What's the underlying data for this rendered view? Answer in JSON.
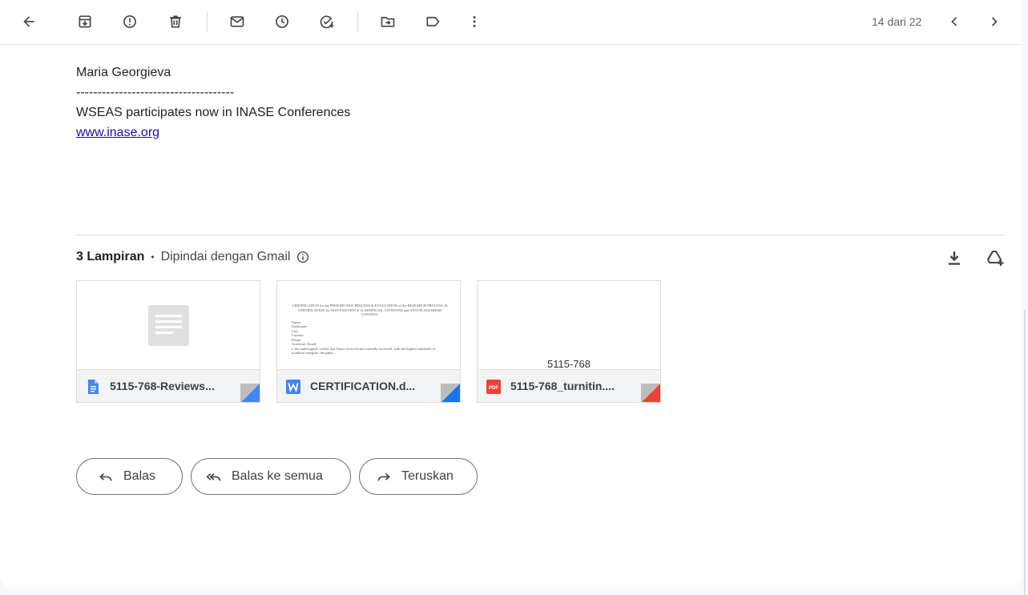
{
  "toolbar": {
    "back_icon": "arrow-left-icon",
    "buttons": [
      "archive-icon",
      "report-spam-icon",
      "delete-icon",
      "mark-unread-icon",
      "snooze-icon",
      "add-task-icon",
      "move-to-icon",
      "label-icon",
      "more-vert-icon"
    ],
    "pager_text": "14 dari 22",
    "prev_icon": "chevron-left-icon",
    "next_icon": "chevron-right-icon"
  },
  "message": {
    "sender_name": "Maria Georgieva",
    "separator": "-------------------------------------",
    "tagline": "WSEAS participates now in INASE Conferences",
    "link": "www.inase.org"
  },
  "attachments": {
    "count_label": "3 Lampiran",
    "bullet": "•",
    "scanned_label": "Dipindai dengan Gmail",
    "download_all_icon": "download-icon",
    "save_to_drive_icon": "add-to-drive-icon",
    "items": [
      {
        "name": "5115-768-Reviews...",
        "type": "gdoc",
        "icon": "google-docs-icon",
        "accent": "#4285f4"
      },
      {
        "name": "CERTIFICATION.d...",
        "type": "word",
        "icon": "word-icon",
        "accent": "#1a73e8",
        "preview_title": "CERTIFICATION for the PEER REVIEW PROCESS & EVALUATION of the RESEARCH PROCESS, & CERTIFICATION for NON EXISTENCE of ARTIFICIAL CITATIONS and ANTI-PLAGIARISM CONTROL",
        "preview_fields": [
          "Name:",
          "Institution:",
          "City:",
          "Country:",
          "Phone:",
          "Academic Email:"
        ],
        "preview_body": "I, the undersigned, certify that I have received and carefully reviewed, with the highest standards of academic integrity, the paper..."
      },
      {
        "name": "5115-768_turnitin....",
        "type": "pdf",
        "icon": "pdf-icon",
        "accent": "#ea4335",
        "preview_text": "5115-768"
      }
    ]
  },
  "actions": {
    "reply": "Balas",
    "reply_all": "Balas ke semua",
    "forward": "Teruskan"
  }
}
